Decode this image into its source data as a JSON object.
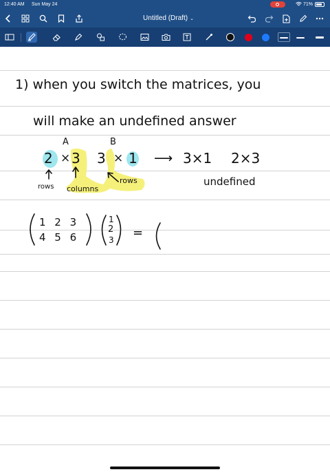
{
  "status": {
    "time": "12:40 AM",
    "date": "Sun May 24",
    "battery": "71%"
  },
  "nav": {
    "title": "Untitled (Draft)"
  },
  "icons": {
    "back": "chevron-left-icon",
    "grid": "grid-icon",
    "search": "search-icon",
    "bookmark": "bookmark-icon",
    "share": "share-icon",
    "undo": "undo-icon",
    "redo": "redo-icon",
    "add_page": "add-page-icon",
    "edit": "edit-icon",
    "more": "more-icon"
  },
  "colors": {
    "nav": "#1f4e86",
    "toolbar": "#173f73",
    "swatch_black": "#111111",
    "swatch_red": "#e0001b",
    "swatch_blue": "#1e7bff",
    "highlight_yellow": "#f5f07a",
    "highlight_cyan": "#9fe6ee"
  },
  "note": {
    "line1": "1) when you switch the matrices, you",
    "line2": "will make an undefined answer",
    "label_a": "A",
    "label_b": "B",
    "dim_a_rows": "2",
    "dim_a_x": "×",
    "dim_a_cols": "3",
    "dim_b_rows": "3",
    "dim_b_x": "×",
    "dim_b_cols": "1",
    "arrow": "⟶",
    "swap_a": "3×1",
    "swap_b": "2×3",
    "rows_left": "rows",
    "columns": "columns",
    "rows_right": "rows",
    "undefined": "undefined",
    "matrix_row1": "1 2 3",
    "matrix_row2": "4 5 6",
    "vector": [
      "1",
      "2",
      "3"
    ],
    "equals": "="
  }
}
